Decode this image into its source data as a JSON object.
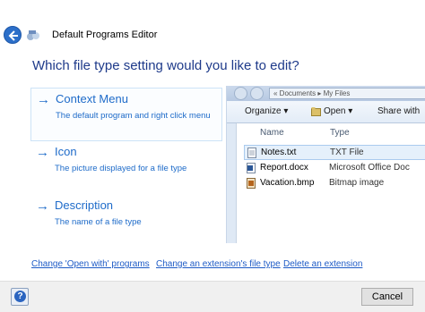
{
  "window": {
    "title": "Default Programs Editor"
  },
  "question": "Which file type setting would you like to edit?",
  "options": [
    {
      "arrow": "→",
      "title": "Context Menu",
      "description": "The default program and right click menu"
    },
    {
      "arrow": "→",
      "title": "Icon",
      "description": "The picture displayed for a file type"
    },
    {
      "arrow": "→",
      "title": "Description",
      "description": "The name of a file type"
    }
  ],
  "preview": {
    "address": "« Documents ▸ My Files",
    "toolbar": {
      "organize": "Organize ▾",
      "open": "Open ▾",
      "share": "Share with"
    },
    "columns": {
      "name": "Name",
      "type": "Type"
    },
    "files": [
      {
        "name": "Notes.txt",
        "type": "TXT File",
        "icon": "text-file-icon",
        "color": "#ffffff"
      },
      {
        "name": "Report.docx",
        "type": "Microsoft Office Doc",
        "icon": "word-file-icon",
        "color": "#2b5797"
      },
      {
        "name": "Vacation.bmp",
        "type": "Bitmap image",
        "icon": "image-file-icon",
        "color": "#b5651d"
      }
    ]
  },
  "links": {
    "open_with": "Change 'Open with' programs",
    "extension_type": "Change an extension's file type",
    "delete_extension": "Delete an extension"
  },
  "footer": {
    "help": "?",
    "cancel": "Cancel"
  },
  "colors": {
    "accent": "#1e6bc9",
    "heading": "#1e3a8a",
    "link": "#1e5bc6"
  }
}
